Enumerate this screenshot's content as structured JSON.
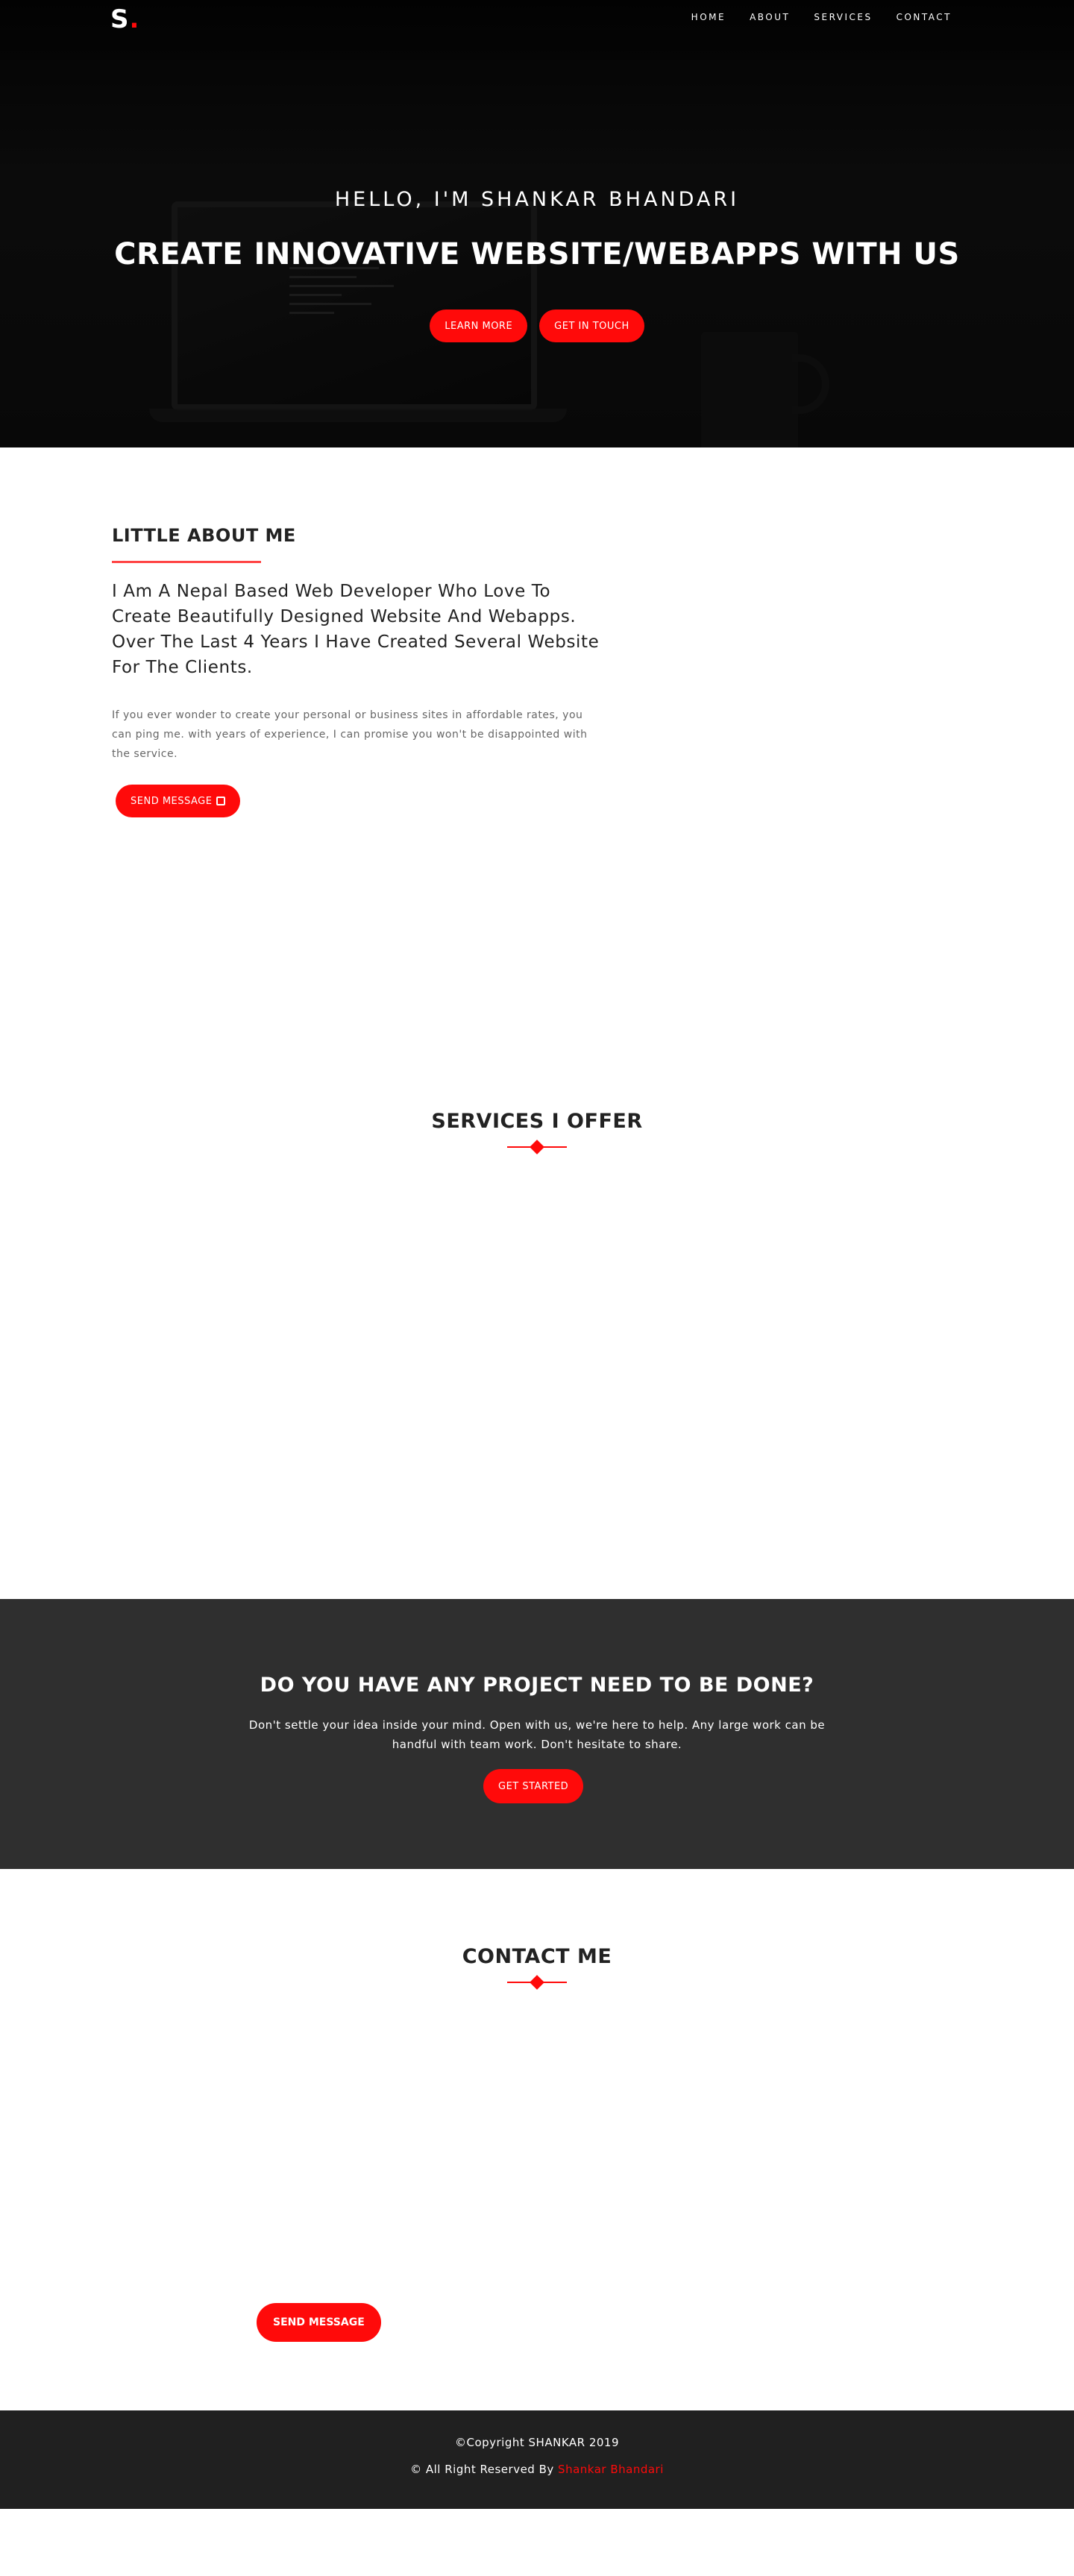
{
  "nav": {
    "logo_letter": "S",
    "logo_dot": ".",
    "links": [
      "HOME",
      "ABOUT",
      "SERVICES",
      "CONTACT"
    ]
  },
  "hero": {
    "subtitle": "HELLO, I'M SHANKAR BHANDARI",
    "title": "CREATE INNOVATIVE WEBSITE/WEBAPPS WITH US",
    "learn_more": "LEARN MORE",
    "get_in_touch": "GET IN TOUCH"
  },
  "about": {
    "title": "LITTLE ABOUT ME",
    "lead": "I Am A Nepal Based Web Developer Who Love To Create Beautifully Designed Website And Webapps. Over The Last 4 Years I Have Created Several Website For The Clients.",
    "text": "If you ever wonder to create your personal or business sites in affordable rates, you can ping me. with years of experience, I can promise you won't be disappointed with the service.",
    "button": "SEND MESSAGE"
  },
  "services": {
    "title": "SERVICES I OFFER"
  },
  "project": {
    "title": "DO YOU HAVE ANY PROJECT NEED TO BE DONE?",
    "text": "Don't settle your idea inside your mind. Open with us, we're here to help. Any large work can be handful with team work. Don't hesitate to share.",
    "button": "GET STARTED"
  },
  "contact": {
    "title": "CONTACT ME",
    "button": "SEND MESSAGE"
  },
  "footer": {
    "copyright": "©Copyright SHANKAR 2019",
    "rights_prefix": "© All Right Reserved By",
    "author": "Shankar Bhandari"
  },
  "colors": {
    "accent": "#ff0a0a",
    "dark_band": "#2f2f2f",
    "footer_bg": "#202020"
  },
  "icons": [
    "message-icon",
    "diamond-divider-icon"
  ]
}
